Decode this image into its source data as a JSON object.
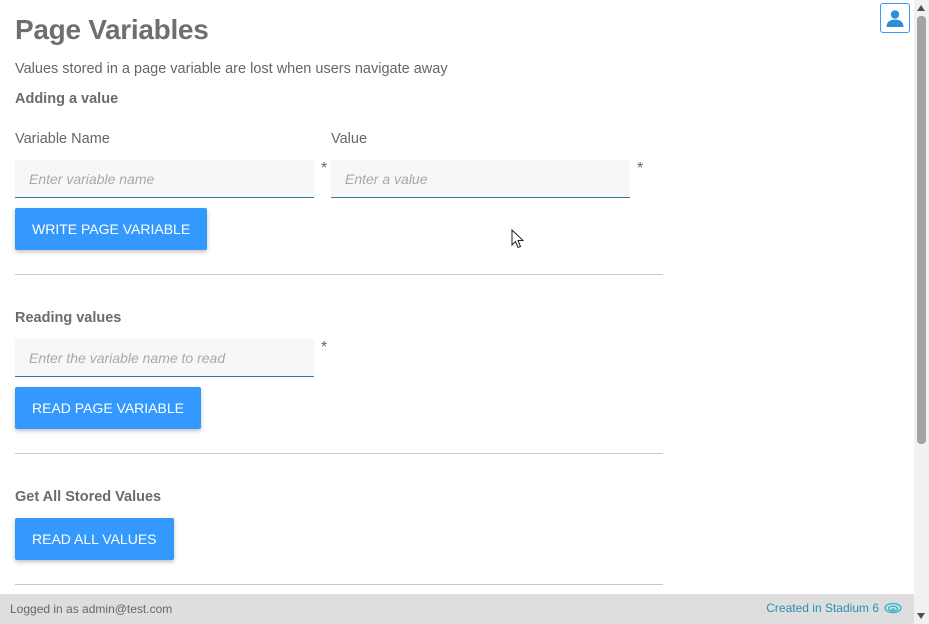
{
  "page": {
    "title": "Page Variables",
    "subtitle": "Values stored in a page variable are lost when users navigate away"
  },
  "adding": {
    "heading": "Adding a value",
    "name_label": "Variable Name",
    "name_placeholder": "Enter variable name",
    "value_label": "Value",
    "value_placeholder": "Enter a value",
    "required_mark": "*",
    "button_label": "WRITE PAGE VARIABLE"
  },
  "reading": {
    "heading": "Reading values",
    "name_placeholder": "Enter the variable name to read",
    "required_mark": "*",
    "button_label": "READ PAGE VARIABLE"
  },
  "all_values": {
    "heading": "Get All Stored Values",
    "button_label": "READ ALL VALUES"
  },
  "footer": {
    "logged_in_text": "Logged in as admin@test.com",
    "created_text": "Created in Stadium 6"
  },
  "icons": {
    "user": "user-icon",
    "stadium": "stadium-logo-icon",
    "cursor": "mouse-pointer-icon"
  },
  "colors": {
    "accent": "#3399ff",
    "input_underline": "#2d7da8",
    "footer_bg": "#dedede",
    "footer_link": "#2a8fb0"
  }
}
